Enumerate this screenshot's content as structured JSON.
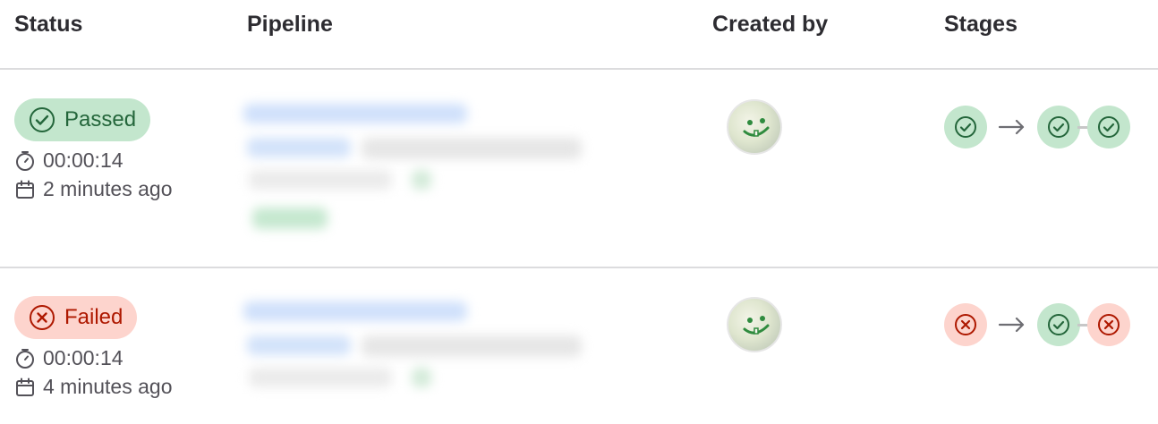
{
  "table": {
    "headers": {
      "status": "Status",
      "pipeline": "Pipeline",
      "created_by": "Created by",
      "stages": "Stages"
    },
    "rows": [
      {
        "status_label": "Passed",
        "status": "passed",
        "duration": "00:00:14",
        "finished": "2 minutes ago",
        "stages": [
          "passed",
          "passed",
          "passed"
        ]
      },
      {
        "status_label": "Failed",
        "status": "failed",
        "duration": "00:00:14",
        "finished": "4 minutes ago",
        "stages": [
          "failed",
          "passed",
          "failed"
        ]
      }
    ]
  },
  "colors": {
    "success_bg": "#c3e6cd",
    "success_fg": "#24663b",
    "danger_bg": "#fdd4cd",
    "danger_fg": "#ae1800"
  },
  "icons": {
    "passed": "status-success-icon",
    "failed": "status-failed-icon",
    "duration": "timer-icon",
    "finished": "calendar-icon"
  }
}
